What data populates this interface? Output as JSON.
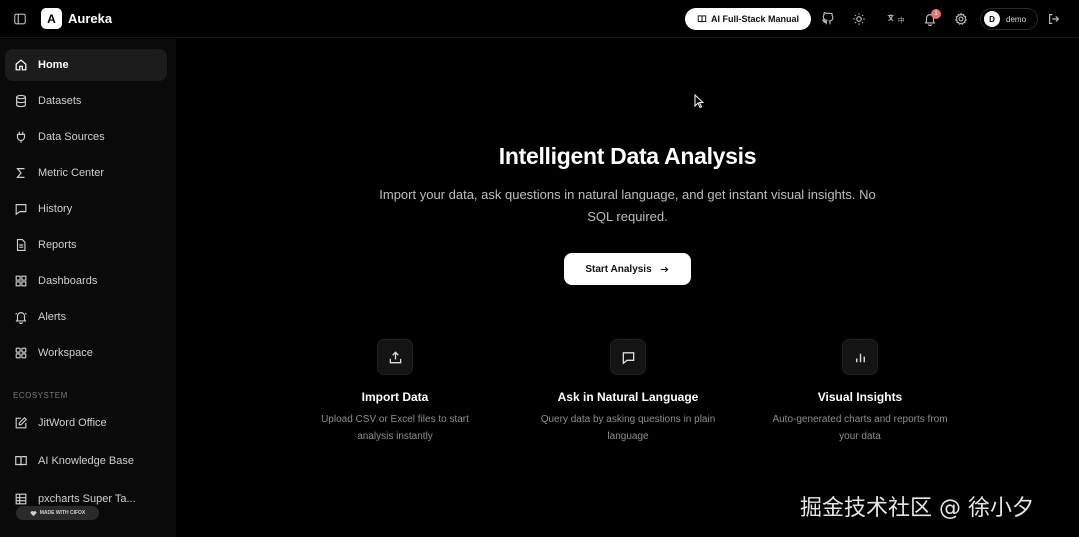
{
  "app": {
    "logo_letter": "A",
    "name": "Aureka"
  },
  "topbar": {
    "manual_label": "AI Full-Stack Manual",
    "notification_count": "1",
    "user": {
      "initial": "D",
      "name": "demo"
    }
  },
  "sidebar": {
    "items": [
      {
        "label": "Home",
        "icon": "home-icon",
        "active": true
      },
      {
        "label": "Datasets",
        "icon": "database-icon"
      },
      {
        "label": "Data Sources",
        "icon": "plug-icon"
      },
      {
        "label": "Metric Center",
        "icon": "sigma-icon"
      },
      {
        "label": "History",
        "icon": "chat-icon"
      },
      {
        "label": "Reports",
        "icon": "document-icon"
      },
      {
        "label": "Dashboards",
        "icon": "grid-icon"
      },
      {
        "label": "Alerts",
        "icon": "bell-icon"
      },
      {
        "label": "Workspace",
        "icon": "workspace-icon"
      }
    ],
    "section_label": "ECOSYSTEM",
    "ecosystem": [
      {
        "label": "JitWord Office",
        "icon": "edit-icon"
      },
      {
        "label": "AI Knowledge Base",
        "icon": "book-icon"
      },
      {
        "label": "pxcharts Super Ta...",
        "icon": "table-icon"
      }
    ],
    "made_with": "MADE WITH CIFOX"
  },
  "hero": {
    "title": "Intelligent Data Analysis",
    "subtitle": "Import your data, ask questions in natural language, and get instant visual insights. No SQL required.",
    "cta_label": "Start Analysis"
  },
  "features": [
    {
      "title": "Import Data",
      "desc": "Upload CSV or Excel files to start analysis instantly",
      "icon": "upload-icon"
    },
    {
      "title": "Ask in Natural Language",
      "desc": "Query data by asking questions in plain language",
      "icon": "message-icon"
    },
    {
      "title": "Visual Insights",
      "desc": "Auto-generated charts and reports from your data",
      "icon": "bar-chart-icon"
    }
  ],
  "watermark": "掘金技术社区 @ 徐小夕"
}
